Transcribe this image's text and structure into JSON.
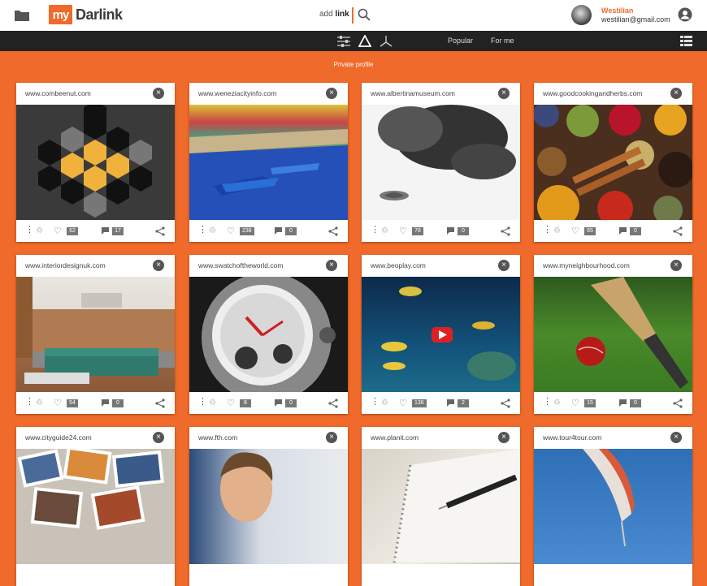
{
  "header": {
    "logo_mark": "my",
    "logo_text": "Darlink",
    "add_prefix": "add ",
    "add_bold": "link",
    "user_name": "Westilian",
    "user_email": "westilian@gmail.com",
    "accent": "#f06a2b"
  },
  "nav": {
    "popular": "Popular",
    "for_me": "For me"
  },
  "private_label": "Private profile",
  "cards": [
    {
      "url": "www.combeenut.com",
      "likes": "62",
      "comments": "17",
      "image": "honeycomb-logo"
    },
    {
      "url": "www.weneziacityinfo.com",
      "likes": "238",
      "comments": "0",
      "image": "venice-canal-boats"
    },
    {
      "url": "www.albertinamuseum.com",
      "likes": "78",
      "comments": "0",
      "image": "ink-sketch-face"
    },
    {
      "url": "www.goodcookingandherbs.com",
      "likes": "65",
      "comments": "0",
      "image": "spice-bowls"
    },
    {
      "url": "www.interiordesignuk.com",
      "likes": "54",
      "comments": "0",
      "image": "living-room-sofa"
    },
    {
      "url": "www.swatchoftheworld.com",
      "likes": "8",
      "comments": "0",
      "image": "watch-closeup"
    },
    {
      "url": "www.beoplay.com",
      "likes": "136",
      "comments": "2",
      "image": "tropical-fish-video"
    },
    {
      "url": "www.myneighbourhood.com",
      "likes": "15",
      "comments": "0",
      "image": "cricket-bat-ball"
    },
    {
      "url": "www.cityguide24.com",
      "likes": "",
      "comments": "",
      "image": "city-photo-collage"
    },
    {
      "url": "www.fth.com",
      "likes": "",
      "comments": "",
      "image": "smiling-man-portrait"
    },
    {
      "url": "www.planit.com",
      "likes": "",
      "comments": "",
      "image": "notebook-pen"
    },
    {
      "url": "www.tour4tour.com",
      "likes": "",
      "comments": "",
      "image": "sky-balloon"
    }
  ]
}
